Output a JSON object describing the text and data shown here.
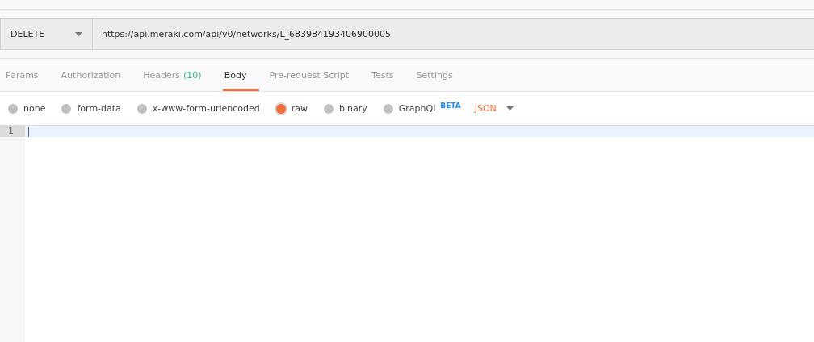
{
  "request": {
    "method": "DELETE",
    "url": "https://api.meraki.com/api/v0/networks/L_683984193406900005"
  },
  "tabs": [
    {
      "label": "Params",
      "selected": false
    },
    {
      "label": "Authorization",
      "selected": false
    },
    {
      "label": "Headers",
      "count": "(10)",
      "selected": false
    },
    {
      "label": "Body",
      "selected": true
    },
    {
      "label": "Pre-request Script",
      "selected": false
    },
    {
      "label": "Tests",
      "selected": false
    },
    {
      "label": "Settings",
      "selected": false
    }
  ],
  "body_types": [
    {
      "label": "none",
      "selected": false
    },
    {
      "label": "form-data",
      "selected": false
    },
    {
      "label": "x-www-form-urlencoded",
      "selected": false
    },
    {
      "label": "raw",
      "selected": true
    },
    {
      "label": "binary",
      "selected": false
    },
    {
      "label": "GraphQL",
      "badge": "BETA",
      "selected": false
    }
  ],
  "format": "JSON",
  "editor": {
    "line_numbers": [
      "1"
    ]
  }
}
